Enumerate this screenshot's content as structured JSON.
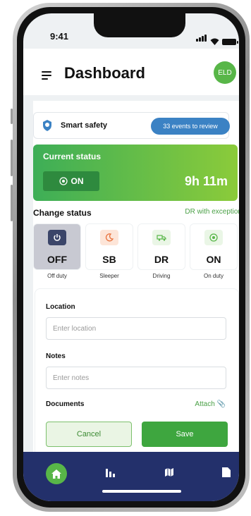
{
  "status_bar": {
    "time": "9:41"
  },
  "header": {
    "title": "Dashboard",
    "avatar": "ELD",
    "menu_icon": "hamburger-icon"
  },
  "safety": {
    "label": "Smart safety",
    "badge": "33 events to review",
    "icon": "shield-icon"
  },
  "current_status": {
    "heading": "Current status",
    "state": "ON",
    "duration": "9h 11m"
  },
  "change_status": {
    "heading": "Change status",
    "exception": "DR with exception",
    "options": [
      {
        "code": "OFF",
        "label": "Off duty",
        "icon": "power-icon",
        "color": "#3b4569"
      },
      {
        "code": "SB",
        "label": "Sleeper",
        "icon": "sleep-icon",
        "color": "#e8703a"
      },
      {
        "code": "DR",
        "label": "Driving",
        "icon": "truck-icon",
        "color": "#58b648"
      },
      {
        "code": "ON",
        "label": "On duty",
        "icon": "target-icon",
        "color": "#58b648"
      }
    ],
    "selected": "OFF"
  },
  "form": {
    "location_label": "Location",
    "location_placeholder": "Enter location",
    "notes_label": "Notes",
    "notes_placeholder": "Enter notes",
    "documents_label": "Documents",
    "attach_label": "Attach",
    "cancel_label": "Cancel",
    "save_label": "Save"
  },
  "bottom_nav": {
    "items": [
      "home-icon",
      "chart-icon",
      "map-icon",
      "document-icon"
    ],
    "active": "home-icon"
  },
  "colors": {
    "accent": "#58b648",
    "nav": "#23306b",
    "badge": "#3b82c4"
  }
}
